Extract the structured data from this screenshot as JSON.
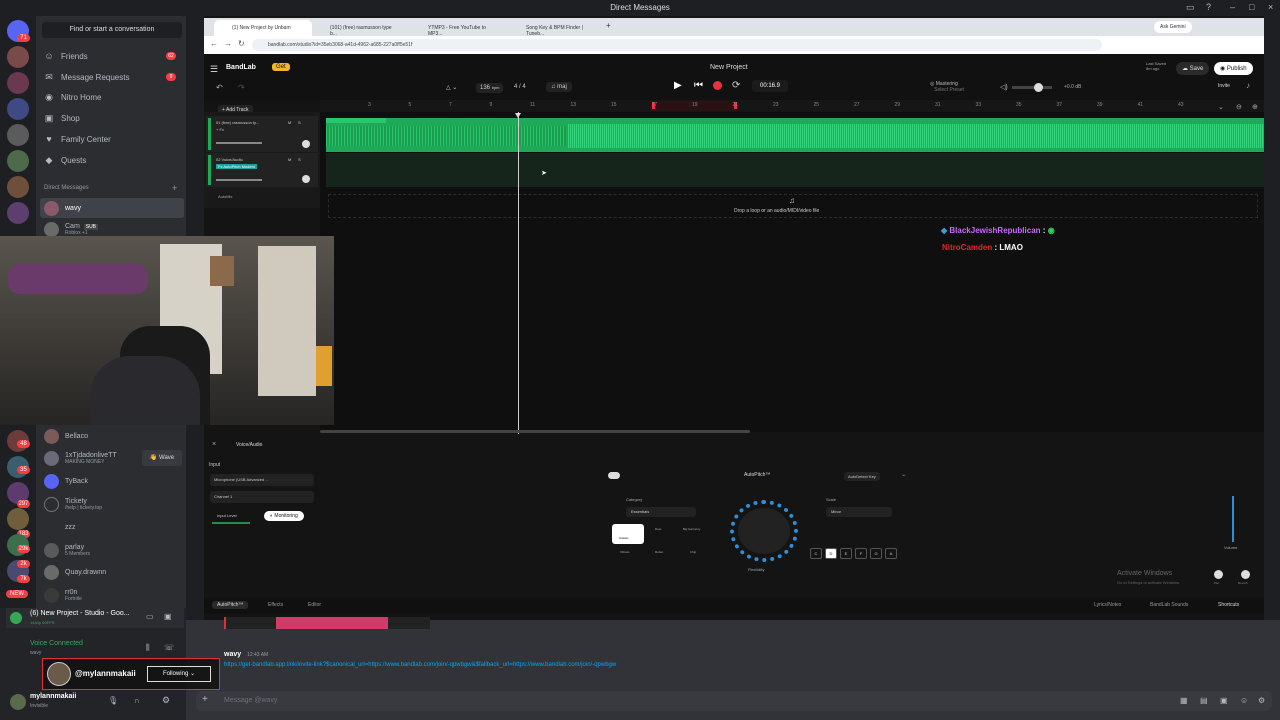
{
  "window": {
    "title": "Direct Messages"
  },
  "discord": {
    "find_label": "Find or start a conversation",
    "nav": [
      {
        "label": "Friends",
        "badge": "62"
      },
      {
        "label": "Message Requests",
        "badge": "9"
      },
      {
        "label": "Nitro Home",
        "badge": ""
      },
      {
        "label": "Shop",
        "badge": ""
      },
      {
        "label": "Family Center",
        "badge": ""
      },
      {
        "label": "Quests",
        "badge": ""
      }
    ],
    "dm_header": "Direct Messages",
    "dms": [
      {
        "name": "wavy",
        "sub": ""
      },
      {
        "name": "Cam",
        "tag": "SUB",
        "sub": "Roblox +1"
      },
      {
        "name": "Bellaco",
        "sub": ""
      },
      {
        "name": "1xTjdadonliveTT",
        "sub": "MAKING MONEY",
        "wave": "Wave"
      },
      {
        "name": "TyBack",
        "sub": ""
      },
      {
        "name": "Tickety",
        "sub": "/help | tickety.top"
      },
      {
        "name": "zzz",
        "sub": ""
      },
      {
        "name": "parlay",
        "sub": "5 Members"
      },
      {
        "name": "Quay.drawnn",
        "sub": ""
      },
      {
        "name": "rr0n",
        "sub": "Fortnite"
      }
    ],
    "server_badges": [
      "71",
      "48",
      "35",
      "297",
      "183",
      "29k",
      "2k",
      "7k",
      "NEW"
    ],
    "stream_title": "(6) New Project - Studio - Goo...",
    "stream_sub": "1440p 60FPS",
    "voice_connected": "Voice Connected",
    "voice_sub": "wavy",
    "streamer_handle": "@mylannmakaii",
    "following_label": "Following",
    "user_name": "mylannmakaii",
    "user_status": "Invisible",
    "message_author": "wavy",
    "message_time": "12:43 AM",
    "message_link": "https://get-bandlab.app.link/invite-link?$canonical_url=https://www.bandlab.com/join/-qpwbgw&$fallback_url=https://www.bandlab.com/join/-qpwbgw",
    "message_placeholder": "Message @wavy"
  },
  "browser": {
    "tabs": [
      "(1) New Project by Unbam",
      "(101) (free) rasmusson type b...",
      "YTMP3 - Free YouTube to MP3...",
      "Song Key & BPM Finder | Tuneb..."
    ],
    "url": "bandlab.com/studio?id=35eb3068-a41d-4962-a685-227a0ff5e51f",
    "ask_gemini": "Ask Gemini"
  },
  "bandlab": {
    "logo": "BandLab",
    "get_label": "Get",
    "project_title": "New Project",
    "tempo": "136",
    "tempo_unit": "bpm",
    "time_sig": "4 / 4",
    "key": "maj",
    "time": "00:16.9",
    "mastering": "Mastering",
    "mastering_sub": "Select Preset",
    "volume_db": "+0.0 dB",
    "save_label": "Save",
    "publish_label": "Publish",
    "last_saved": "Last Saved",
    "last_saved_sub": "8m ago",
    "invite": "Invite",
    "add_track": "+ Add Track",
    "ruler": [
      "3",
      "5",
      "7",
      "9",
      "11",
      "13",
      "15",
      "17",
      "19",
      "21",
      "23",
      "25",
      "27",
      "29",
      "31",
      "33",
      "35",
      "37",
      "39",
      "41",
      "43"
    ],
    "tracks": [
      {
        "name": "01 (free) rasmusson ty...",
        "fx": "+ Fx"
      },
      {
        "name": "02 Voice/Audio",
        "fx": "Fx AutoPitch Modern"
      }
    ],
    "automix": "AutoMix",
    "drop_text": "Drop a loop or an audio/MIDI/video file",
    "panel_title": "Voice/Audio",
    "input_label": "Input",
    "mic": "Microphone (USB Advanced ...",
    "channel": "Channel 1",
    "input_level": "Input Level",
    "monitoring": "Monitoring",
    "autopitch_title": "AutoPitch™",
    "autodetect": "AutoDetect Key",
    "category_label": "Category",
    "category_value": "Essentials",
    "scale_label": "Scale",
    "scale_value": "Minor",
    "flexibility": "Flexibility",
    "presets": [
      "Classic",
      "Duet",
      "Big Harmony",
      "Vibrato",
      "Robot",
      "Chip"
    ],
    "keys": [
      "C",
      "D",
      "E",
      "F",
      "G",
      "A"
    ],
    "volume_label": "Volume",
    "tabs": [
      "AutoPitch™",
      "Effects",
      "Editor"
    ],
    "footer": [
      "Lyrics/Notes",
      "BandLab Sounds",
      "Shortcuts"
    ],
    "pan_label": "Pan",
    "reverb_label": "Reverb"
  },
  "overlay": {
    "chat": [
      {
        "user": "BlackJewishRepublican",
        "sep": ":",
        "text": "",
        "color": "#c86bff"
      },
      {
        "user": "NitroCamden",
        "sep": ":",
        "text": "LMAO",
        "color": "#e0262a"
      }
    ],
    "activate_title": "Activate Windows",
    "activate_sub": "Go to Settings to activate Windows."
  }
}
